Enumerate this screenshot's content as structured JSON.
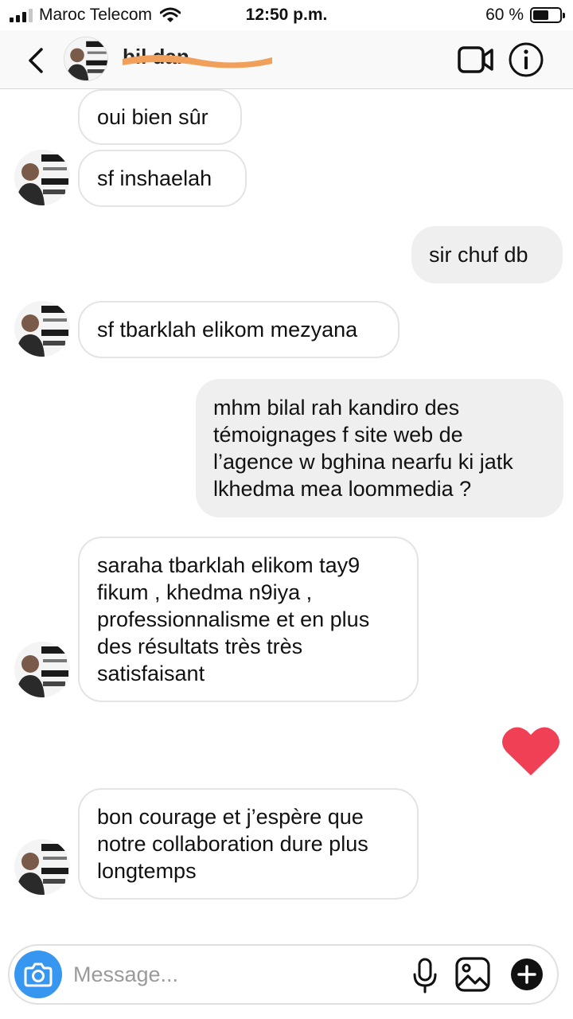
{
  "status_bar": {
    "carrier": "Maroc Telecom",
    "time": "12:50 p.m.",
    "battery": "60 %",
    "battery_level": 0.6,
    "signal_bars": 3
  },
  "header": {
    "contact_name": "bil          dan",
    "icons": [
      "chevron-left-icon",
      "video-camera-icon",
      "info-icon"
    ]
  },
  "colors": {
    "outgoing_bubble": "#efefef",
    "incoming_border": "#e4e4e4",
    "heart": "#ef4056",
    "camera_button": "#3797f0"
  },
  "messages": [
    {
      "direction": "in",
      "text": "oui bien sûr"
    },
    {
      "direction": "in",
      "text": "sf inshaelah"
    },
    {
      "direction": "out",
      "text": "sir chuf db"
    },
    {
      "direction": "in",
      "text": "sf tbarklah elikom mezyana"
    },
    {
      "direction": "out",
      "text": "mhm bilal rah kandiro des\ntémoignages f site web de\nl’agence w bghina nearfu ki jatk\nlkhedma mea loommedia ?"
    },
    {
      "direction": "in",
      "text": "saraha tbarklah elikom tay9\nfikum , khedma n9iya ,\nprofessionnalisme et en plus\ndes résultats très très\nsatisfaisant"
    },
    {
      "direction": "out",
      "text": "",
      "reaction": "heart"
    },
    {
      "direction": "in",
      "text": "bon courage et j’espère que\nnotre collaboration dure plus\nlongtemps"
    }
  ],
  "composer": {
    "placeholder": "Message..."
  }
}
